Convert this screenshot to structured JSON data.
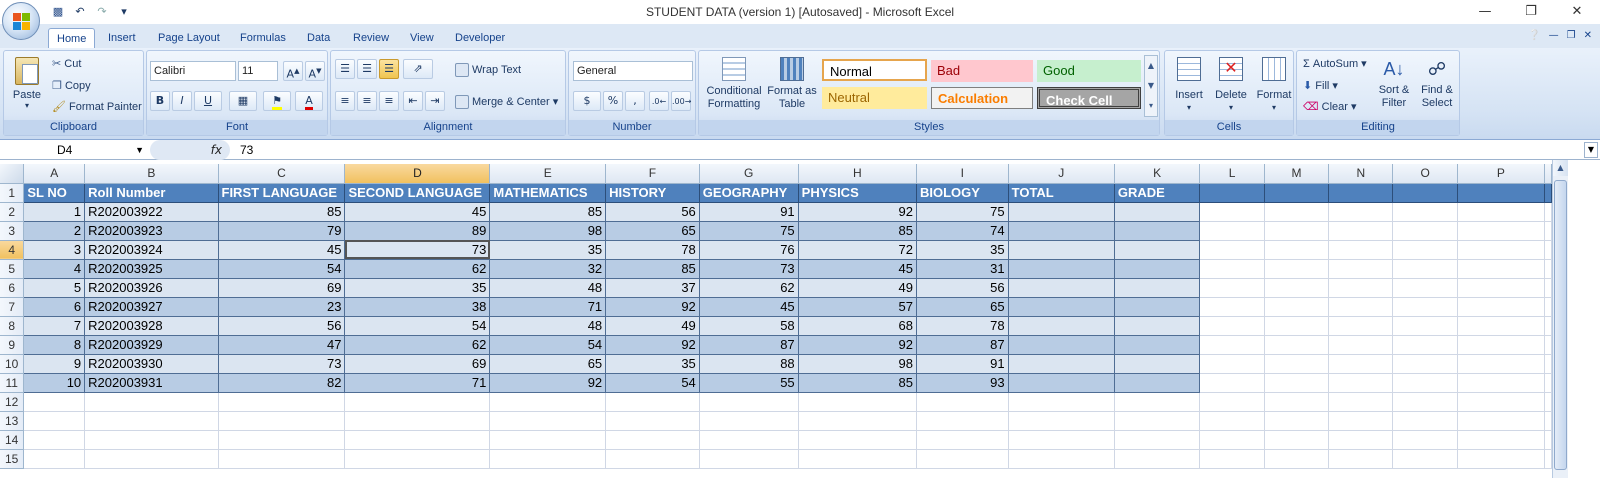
{
  "window": {
    "title": "STUDENT DATA (version 1) [Autosaved] - Microsoft Excel"
  },
  "tabs": [
    "Home",
    "Insert",
    "Page Layout",
    "Formulas",
    "Data",
    "Review",
    "View",
    "Developer"
  ],
  "clipboard": {
    "paste": "Paste",
    "cut": "Cut",
    "copy": "Copy",
    "format_painter": "Format Painter",
    "label": "Clipboard"
  },
  "font": {
    "name": "Calibri",
    "size": "11",
    "label": "Font",
    "bold": "B",
    "italic": "I",
    "underline": "U"
  },
  "alignment": {
    "wrap": "Wrap Text",
    "merge": "Merge & Center",
    "label": "Alignment"
  },
  "number": {
    "format": "General",
    "currency": "$",
    "percent": "%",
    "comma": ",",
    "label": "Number"
  },
  "styles": {
    "conditional": "Conditional Formatting",
    "format_table": "Format as Table",
    "normal": "Normal",
    "bad": "Bad",
    "good": "Good",
    "neutral": "Neutral",
    "calculation": "Calculation",
    "check_cell": "Check Cell",
    "label": "Styles"
  },
  "cells": {
    "insert": "Insert",
    "delete": "Delete",
    "format": "Format",
    "label": "Cells"
  },
  "editing": {
    "autosum": "AutoSum",
    "fill": "Fill",
    "clear": "Clear",
    "sort": "Sort & Filter",
    "find": "Find & Select",
    "label": "Editing"
  },
  "formula_bar": {
    "name_box": "D4",
    "fx": "fx",
    "value": "73"
  },
  "sheet": {
    "columns": [
      "A",
      "B",
      "C",
      "D",
      "E",
      "F",
      "G",
      "H",
      "I",
      "J",
      "K",
      "L",
      "M",
      "N",
      "O",
      "P"
    ],
    "selected_column": "D",
    "selected_row": 4,
    "headers": [
      "SL NO",
      "Roll Number",
      "FIRST LANGUAGE",
      "SECOND LANGUAGE",
      "MATHEMATICS",
      "HISTORY",
      "GEOGRAPHY",
      "PHYSICS",
      "BIOLOGY",
      "TOTAL",
      "GRADE"
    ],
    "rows": [
      [
        "1",
        "R202003922",
        "85",
        "45",
        "85",
        "56",
        "91",
        "92",
        "75",
        "",
        ""
      ],
      [
        "2",
        "R202003923",
        "79",
        "89",
        "98",
        "65",
        "75",
        "85",
        "74",
        "",
        ""
      ],
      [
        "3",
        "R202003924",
        "45",
        "73",
        "35",
        "78",
        "76",
        "72",
        "35",
        "",
        ""
      ],
      [
        "4",
        "R202003925",
        "54",
        "62",
        "32",
        "85",
        "73",
        "45",
        "31",
        "",
        ""
      ],
      [
        "5",
        "R202003926",
        "69",
        "35",
        "48",
        "37",
        "62",
        "49",
        "56",
        "",
        ""
      ],
      [
        "6",
        "R202003927",
        "23",
        "38",
        "71",
        "92",
        "45",
        "57",
        "65",
        "",
        ""
      ],
      [
        "7",
        "R202003928",
        "56",
        "54",
        "48",
        "49",
        "58",
        "68",
        "78",
        "",
        ""
      ],
      [
        "8",
        "R202003929",
        "47",
        "62",
        "54",
        "92",
        "87",
        "92",
        "87",
        "",
        ""
      ],
      [
        "9",
        "R202003930",
        "73",
        "69",
        "65",
        "35",
        "88",
        "98",
        "91",
        "",
        ""
      ],
      [
        "10",
        "R202003931",
        "82",
        "71",
        "92",
        "54",
        "55",
        "85",
        "93",
        "",
        ""
      ]
    ],
    "empty_rows": [
      "12",
      "13",
      "14",
      "15"
    ]
  }
}
